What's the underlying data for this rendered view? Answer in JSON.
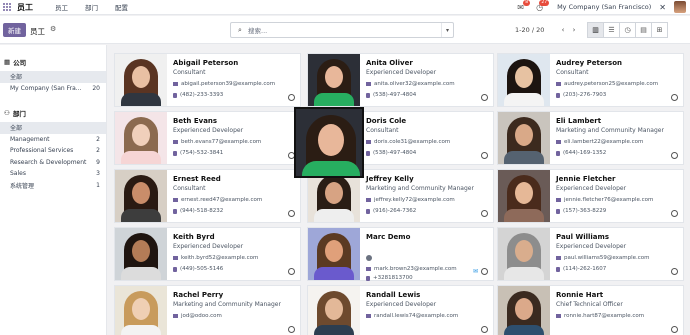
{
  "topbar": {
    "brand": "员工",
    "menu": [
      "员工",
      "部门",
      "配置"
    ],
    "messages_count": "8",
    "activities_count": "27",
    "company": "My Company (San Francisco)"
  },
  "control": {
    "new_label": "新建",
    "breadcrumb": "员工",
    "search_placeholder": "搜索...",
    "pager": "1-20 / 20"
  },
  "sidebar": {
    "company_title": "公司",
    "companies": [
      {
        "label": "全部",
        "count": ""
      },
      {
        "label": "My Company (San Fra...",
        "count": "20"
      }
    ],
    "department_title": "部门",
    "departments": [
      {
        "label": "全部",
        "count": ""
      },
      {
        "label": "Management",
        "count": "2"
      },
      {
        "label": "Professional Services",
        "count": "2"
      },
      {
        "label": "Research & Development",
        "count": "9"
      },
      {
        "label": "Sales",
        "count": "3"
      },
      {
        "label": "系统管理",
        "count": "1"
      }
    ]
  },
  "employees": [
    {
      "name": "Abigail Peterson",
      "title": "Consultant",
      "email": "abigail.peterson39@example.com",
      "phone": "(482)-233-3393",
      "skin": "#e9c0a3",
      "hair": "#5a3422",
      "shirt": "#2f3640",
      "bg": "#f0f0f0"
    },
    {
      "name": "Anita Oliver",
      "title": "Experienced Developer",
      "email": "anita.oliver32@example.com",
      "phone": "(538)-497-4804",
      "skin": "#e8b79a",
      "hair": "#2b1d14",
      "shirt": "#27ae60",
      "bg": "#2c2f37"
    },
    {
      "name": "Audrey Peterson",
      "title": "Consultant",
      "email": "audrey.peterson25@example.com",
      "phone": "(203)-276-7903",
      "skin": "#e7c2a2",
      "hair": "#1c1410",
      "shirt": "#f4f4f4",
      "bg": "#dfe7ef"
    },
    {
      "name": "Beth Evans",
      "title": "Experienced Developer",
      "email": "beth.evans77@example.com",
      "phone": "(754)-532-3841",
      "skin": "#f0d0bb",
      "hair": "#8b6a4f",
      "shirt": "#f6d5d5",
      "bg": "#f4e5e8"
    },
    {
      "name": "Doris Cole",
      "title": "Consultant",
      "email": "doris.cole31@example.com",
      "phone": "(538)-497-4804",
      "skin": "#e8b79a",
      "hair": "#2b1d14",
      "shirt": "#27ae60",
      "bg": "#2c2f37"
    },
    {
      "name": "Eli Lambert",
      "title": "Marketing and Community Manager",
      "email": "eli.lambert22@example.com",
      "phone": "(644)-169-1352",
      "skin": "#d9a988",
      "hair": "#3c2a1e",
      "shirt": "#556270",
      "bg": "#c9c4bd"
    },
    {
      "name": "Ernest Reed",
      "title": "Consultant",
      "email": "ernest.reed47@example.com",
      "phone": "(944)-518-8232",
      "skin": "#c98d6a",
      "hair": "#2a1a12",
      "shirt": "#3d3d3d",
      "bg": "#d7cfc5"
    },
    {
      "name": "Jeffrey Kelly",
      "title": "Marketing and Community Manager",
      "email": "jeffrey.kelly72@example.com",
      "phone": "(916)-264-7362",
      "skin": "#d7a383",
      "hair": "#2a1d15",
      "shirt": "#eeeeee",
      "bg": "#e8e2da"
    },
    {
      "name": "Jennie Fletcher",
      "title": "Experienced Developer",
      "email": "jennie.fletcher76@example.com",
      "phone": "(157)-363-8229",
      "skin": "#e6b897",
      "hair": "#4a2b1c",
      "shirt": "#8e6a5a",
      "bg": "#6a5b57"
    },
    {
      "name": "Keith Byrd",
      "title": "Experienced Developer",
      "email": "keith.byrd52@example.com",
      "phone": "(449)-505-5146",
      "skin": "#b37c57",
      "hair": "#1f1510",
      "shirt": "#dcdcdc",
      "bg": "#cfd4d8"
    },
    {
      "name": "Marc Demo",
      "title": "",
      "email": "mark.brown23@example.com",
      "phone": "+3281813700",
      "skin": "#e0a07a",
      "hair": "#5b3a22",
      "shirt": "#6a5acd",
      "bg": "#9ea7d8"
    },
    {
      "name": "Paul Williams",
      "title": "Experienced Developer",
      "email": "paul.williams59@example.com",
      "phone": "(114)-262-1607",
      "skin": "#d9ad8d",
      "hair": "#8d8d8d",
      "shirt": "#e7e7e7",
      "bg": "#d4d4d4"
    },
    {
      "name": "Rachel Perry",
      "title": "Marketing and Community Manager",
      "email": "jod@odoo.com",
      "phone": "",
      "skin": "#efcfb4",
      "hair": "#c89b5c",
      "shirt": "#f3f3f3",
      "bg": "#eae5d8"
    },
    {
      "name": "Randall Lewis",
      "title": "Experienced Developer",
      "email": "randall.lewis74@example.com",
      "phone": "",
      "skin": "#e3b898",
      "hair": "#6e4a2e",
      "shirt": "#2d3e50",
      "bg": "#f5f3f0"
    },
    {
      "name": "Ronnie Hart",
      "title": "Chief Technical Officer",
      "email": "ronnie.hart87@example.com",
      "phone": "",
      "skin": "#dba98a",
      "hair": "#3a2a20",
      "shirt": "#2e4f6e",
      "bg": "#c8c0b5"
    }
  ]
}
